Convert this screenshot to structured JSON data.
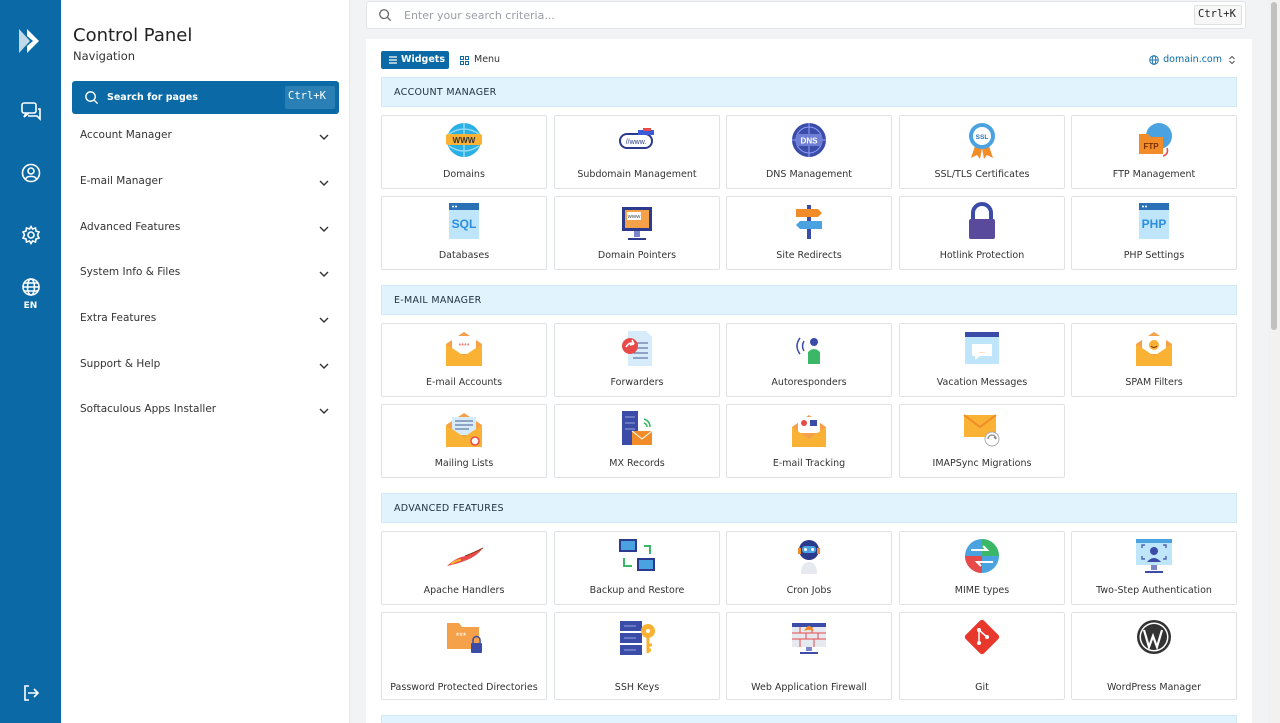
{
  "rail": {
    "icons": [
      "logo-icon",
      "chat-icon",
      "user-icon",
      "settings-icon",
      "globe-icon",
      "logout-icon"
    ],
    "lang": "EN",
    "bg": "#0b6aa6"
  },
  "nav": {
    "title": "Control Panel",
    "subtitle": "Navigation",
    "search_label": "Search for pages",
    "search_kbd": "Ctrl+K",
    "items": [
      {
        "label": "Account Manager"
      },
      {
        "label": "E-mail Manager"
      },
      {
        "label": "Advanced Features"
      },
      {
        "label": "System Info & Files"
      },
      {
        "label": "Extra Features"
      },
      {
        "label": "Support & Help"
      },
      {
        "label": "Softaculous Apps Installer"
      }
    ]
  },
  "search": {
    "placeholder": "Enter your search criteria...",
    "kbd": "Ctrl+K"
  },
  "toolbar": {
    "widgets_label": "Widgets",
    "menu_label": "Menu",
    "domain": "domain.com"
  },
  "sections": [
    {
      "title": "ACCOUNT MANAGER",
      "tiles": [
        {
          "label": "Domains",
          "icon": "www-globe-icon"
        },
        {
          "label": "Subdomain Management",
          "icon": "subdomain-icon"
        },
        {
          "label": "DNS Management",
          "icon": "dns-globe-icon"
        },
        {
          "label": "SSL/TLS Certificates",
          "icon": "ssl-badge-icon"
        },
        {
          "label": "FTP Management",
          "icon": "ftp-folder-icon"
        },
        {
          "label": "Databases",
          "icon": "sql-icon"
        },
        {
          "label": "Domain Pointers",
          "icon": "domain-pointer-icon"
        },
        {
          "label": "Site Redirects",
          "icon": "signpost-icon"
        },
        {
          "label": "Hotlink Protection",
          "icon": "padlock-icon"
        },
        {
          "label": "PHP Settings",
          "icon": "php-icon"
        }
      ]
    },
    {
      "title": "E-MAIL MANAGER",
      "tiles": [
        {
          "label": "E-mail Accounts",
          "icon": "open-envelope-icon"
        },
        {
          "label": "Forwarders",
          "icon": "forward-doc-icon"
        },
        {
          "label": "Autoresponders",
          "icon": "person-signal-icon"
        },
        {
          "label": "Vacation Messages",
          "icon": "chat-window-icon"
        },
        {
          "label": "SPAM Filters",
          "icon": "smiley-envelope-icon"
        },
        {
          "label": "Mailing Lists",
          "icon": "list-envelope-icon"
        },
        {
          "label": "MX Records",
          "icon": "server-mail-icon"
        },
        {
          "label": "E-mail Tracking",
          "icon": "tracking-envelope-icon"
        },
        {
          "label": "IMAPSync Migrations",
          "icon": "sync-envelope-icon"
        }
      ]
    },
    {
      "title": "ADVANCED FEATURES",
      "tiles": [
        {
          "label": "Apache Handlers",
          "icon": "apache-feather-icon"
        },
        {
          "label": "Backup and Restore",
          "icon": "backup-monitors-icon"
        },
        {
          "label": "Cron Jobs",
          "icon": "robot-icon"
        },
        {
          "label": "MIME types",
          "icon": "mime-icon"
        },
        {
          "label": "Two-Step Authentication",
          "icon": "two-step-auth-icon"
        },
        {
          "label": "Password Protected Directories",
          "icon": "locked-folder-icon"
        },
        {
          "label": "SSH Keys",
          "icon": "ssh-key-icon"
        },
        {
          "label": "Web Application Firewall",
          "icon": "firewall-icon"
        },
        {
          "label": "Git",
          "icon": "git-icon"
        },
        {
          "label": "WordPress Manager",
          "icon": "wordpress-icon"
        }
      ]
    }
  ]
}
